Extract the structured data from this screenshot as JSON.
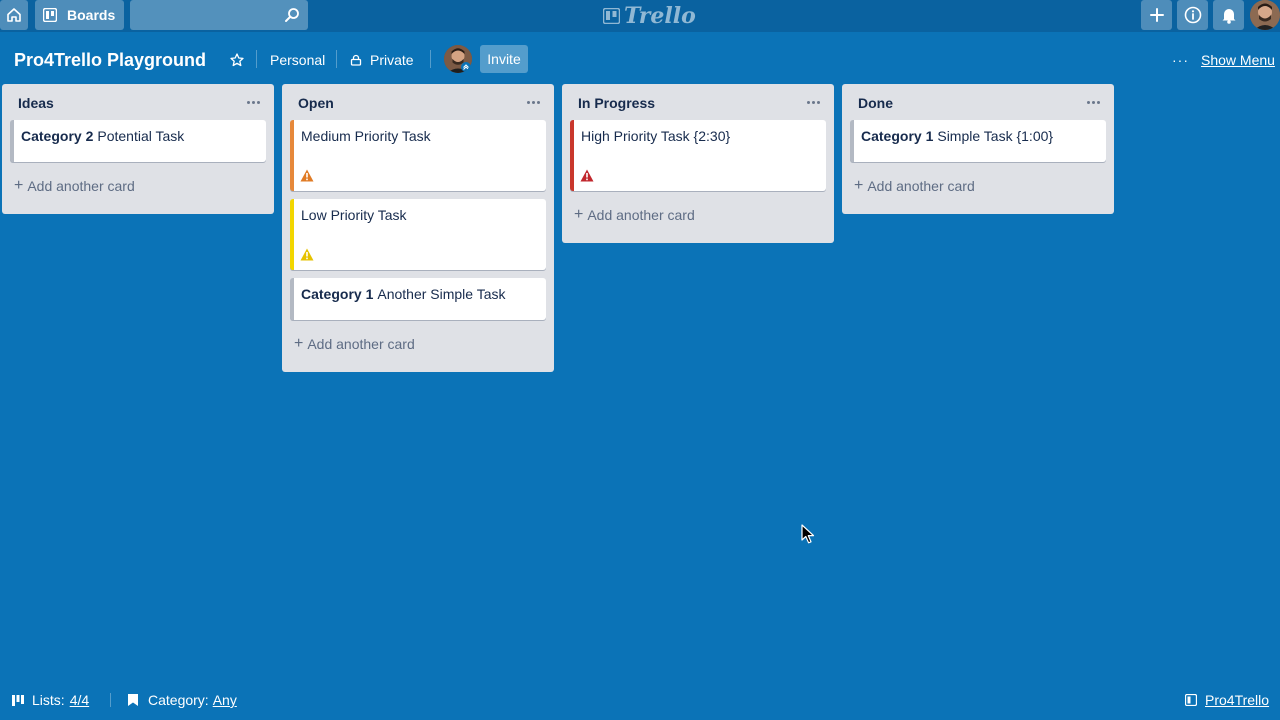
{
  "header": {
    "boards_label": "Boards",
    "search_value": "",
    "logo_text": "Trello",
    "icons": [
      "home-icon",
      "board-icon",
      "search-icon",
      "plus-icon",
      "info-icon",
      "bell-icon"
    ]
  },
  "board": {
    "title": "Pro4Trello Playground",
    "visibility_team": "Personal",
    "visibility_privacy": "Private",
    "invite_label": "Invite",
    "show_menu_label": "Show Menu",
    "background_color": "#0b73b7"
  },
  "lists": [
    {
      "title": "Ideas",
      "cards": [
        {
          "category": "Category 2",
          "title": "Potential Task",
          "label_color": "#b3b9c3",
          "warning": false
        }
      ],
      "add_label": "Add another card"
    },
    {
      "title": "Open",
      "cards": [
        {
          "category": "",
          "title": "Medium Priority Task",
          "label_color": "#e6883a",
          "warning": true,
          "warning_color": "#e07b25"
        },
        {
          "category": "",
          "title": "Low Priority Task",
          "label_color": "#f2d600",
          "warning": true,
          "warning_color": "#e6c200"
        },
        {
          "category": "Category 1",
          "title": "Another Simple Task",
          "label_color": "#b3b9c3",
          "warning": false
        }
      ],
      "add_label": "Add another card"
    },
    {
      "title": "In Progress",
      "cards": [
        {
          "category": "",
          "title": "High Priority Task {2:30}",
          "label_color": "#c9372c",
          "warning": true,
          "warning_color": "#c1272d"
        }
      ],
      "add_label": "Add another card"
    },
    {
      "title": "Done",
      "cards": [
        {
          "category": "Category 1",
          "title": "Simple Task {1:00}",
          "label_color": "#b3b9c3",
          "warning": false
        }
      ],
      "add_label": "Add another card"
    }
  ],
  "footer": {
    "lists_label": "Lists:",
    "lists_value": "4/4",
    "category_label": "Category:",
    "category_value": "Any",
    "brand_label": "Pro4Trello"
  }
}
